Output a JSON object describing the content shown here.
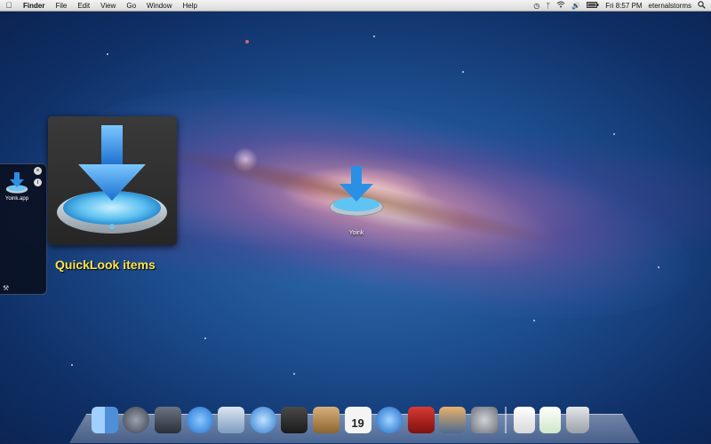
{
  "menubar": {
    "app_name": "Finder",
    "menus": [
      "File",
      "Edit",
      "View",
      "Go",
      "Window",
      "Help"
    ],
    "clock": "Fri 8:57 PM",
    "user": "eternalstorms",
    "icons": [
      "time-machine-icon",
      "bluetooth-icon",
      "wifi-icon",
      "volume-icon",
      "battery-icon",
      "spotlight-icon"
    ]
  },
  "shelf": {
    "item_label": "Yoink.app",
    "close_glyph": "×",
    "info_glyph": "i",
    "tools_glyph": "⚒"
  },
  "quicklook": {
    "annotation": "QuickLook items"
  },
  "desktop": {
    "icon_label": "Yoink"
  },
  "dock": {
    "items": [
      {
        "name": "finder",
        "color": "#4f8fd8"
      },
      {
        "name": "launchpad",
        "color": "#555b66"
      },
      {
        "name": "mission-control",
        "color": "#3a3f4a"
      },
      {
        "name": "app-store",
        "color": "#2f7ee0"
      },
      {
        "name": "mail",
        "color": "#4d7fbf"
      },
      {
        "name": "safari",
        "color": "#3d8fe0"
      },
      {
        "name": "facetime",
        "color": "#2c2c2c"
      },
      {
        "name": "address-book",
        "color": "#b58c52"
      },
      {
        "name": "ical",
        "color": "#e9e9e9"
      },
      {
        "name": "itunes",
        "color": "#2d6fd0"
      },
      {
        "name": "photo-booth",
        "color": "#b3201e"
      },
      {
        "name": "iphoto",
        "color": "#5f7a9a"
      },
      {
        "name": "system-preferences",
        "color": "#8a8f96"
      },
      {
        "name": "documents",
        "color": "#f2f2f2"
      },
      {
        "name": "downloads",
        "color": "#f4f4f4"
      },
      {
        "name": "trash",
        "color": "#c9ccd1"
      }
    ],
    "calendar_day": "19"
  },
  "colors": {
    "annotation": "#ffe34a",
    "menubar": "#e6e6e6",
    "arrow_blue": "#2b8fe6"
  }
}
